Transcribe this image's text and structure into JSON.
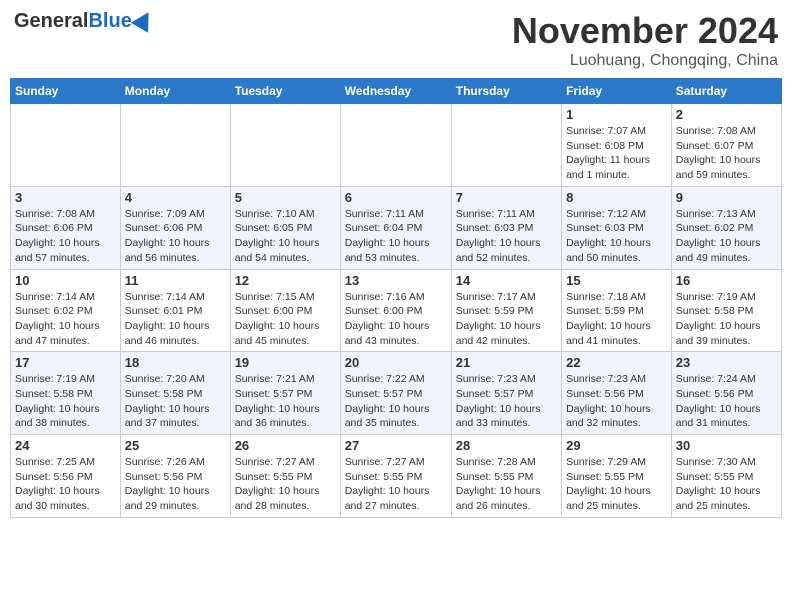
{
  "header": {
    "logo_general": "General",
    "logo_blue": "Blue",
    "month_title": "November 2024",
    "location": "Luohuang, Chongqing, China"
  },
  "weekdays": [
    "Sunday",
    "Monday",
    "Tuesday",
    "Wednesday",
    "Thursday",
    "Friday",
    "Saturday"
  ],
  "weeks": [
    [
      {
        "day": "",
        "info": ""
      },
      {
        "day": "",
        "info": ""
      },
      {
        "day": "",
        "info": ""
      },
      {
        "day": "",
        "info": ""
      },
      {
        "day": "",
        "info": ""
      },
      {
        "day": "1",
        "info": "Sunrise: 7:07 AM\nSunset: 6:08 PM\nDaylight: 11 hours and 1 minute."
      },
      {
        "day": "2",
        "info": "Sunrise: 7:08 AM\nSunset: 6:07 PM\nDaylight: 10 hours and 59 minutes."
      }
    ],
    [
      {
        "day": "3",
        "info": "Sunrise: 7:08 AM\nSunset: 6:06 PM\nDaylight: 10 hours and 57 minutes."
      },
      {
        "day": "4",
        "info": "Sunrise: 7:09 AM\nSunset: 6:06 PM\nDaylight: 10 hours and 56 minutes."
      },
      {
        "day": "5",
        "info": "Sunrise: 7:10 AM\nSunset: 6:05 PM\nDaylight: 10 hours and 54 minutes."
      },
      {
        "day": "6",
        "info": "Sunrise: 7:11 AM\nSunset: 6:04 PM\nDaylight: 10 hours and 53 minutes."
      },
      {
        "day": "7",
        "info": "Sunrise: 7:11 AM\nSunset: 6:03 PM\nDaylight: 10 hours and 52 minutes."
      },
      {
        "day": "8",
        "info": "Sunrise: 7:12 AM\nSunset: 6:03 PM\nDaylight: 10 hours and 50 minutes."
      },
      {
        "day": "9",
        "info": "Sunrise: 7:13 AM\nSunset: 6:02 PM\nDaylight: 10 hours and 49 minutes."
      }
    ],
    [
      {
        "day": "10",
        "info": "Sunrise: 7:14 AM\nSunset: 6:02 PM\nDaylight: 10 hours and 47 minutes."
      },
      {
        "day": "11",
        "info": "Sunrise: 7:14 AM\nSunset: 6:01 PM\nDaylight: 10 hours and 46 minutes."
      },
      {
        "day": "12",
        "info": "Sunrise: 7:15 AM\nSunset: 6:00 PM\nDaylight: 10 hours and 45 minutes."
      },
      {
        "day": "13",
        "info": "Sunrise: 7:16 AM\nSunset: 6:00 PM\nDaylight: 10 hours and 43 minutes."
      },
      {
        "day": "14",
        "info": "Sunrise: 7:17 AM\nSunset: 5:59 PM\nDaylight: 10 hours and 42 minutes."
      },
      {
        "day": "15",
        "info": "Sunrise: 7:18 AM\nSunset: 5:59 PM\nDaylight: 10 hours and 41 minutes."
      },
      {
        "day": "16",
        "info": "Sunrise: 7:19 AM\nSunset: 5:58 PM\nDaylight: 10 hours and 39 minutes."
      }
    ],
    [
      {
        "day": "17",
        "info": "Sunrise: 7:19 AM\nSunset: 5:58 PM\nDaylight: 10 hours and 38 minutes."
      },
      {
        "day": "18",
        "info": "Sunrise: 7:20 AM\nSunset: 5:58 PM\nDaylight: 10 hours and 37 minutes."
      },
      {
        "day": "19",
        "info": "Sunrise: 7:21 AM\nSunset: 5:57 PM\nDaylight: 10 hours and 36 minutes."
      },
      {
        "day": "20",
        "info": "Sunrise: 7:22 AM\nSunset: 5:57 PM\nDaylight: 10 hours and 35 minutes."
      },
      {
        "day": "21",
        "info": "Sunrise: 7:23 AM\nSunset: 5:57 PM\nDaylight: 10 hours and 33 minutes."
      },
      {
        "day": "22",
        "info": "Sunrise: 7:23 AM\nSunset: 5:56 PM\nDaylight: 10 hours and 32 minutes."
      },
      {
        "day": "23",
        "info": "Sunrise: 7:24 AM\nSunset: 5:56 PM\nDaylight: 10 hours and 31 minutes."
      }
    ],
    [
      {
        "day": "24",
        "info": "Sunrise: 7:25 AM\nSunset: 5:56 PM\nDaylight: 10 hours and 30 minutes."
      },
      {
        "day": "25",
        "info": "Sunrise: 7:26 AM\nSunset: 5:56 PM\nDaylight: 10 hours and 29 minutes."
      },
      {
        "day": "26",
        "info": "Sunrise: 7:27 AM\nSunset: 5:55 PM\nDaylight: 10 hours and 28 minutes."
      },
      {
        "day": "27",
        "info": "Sunrise: 7:27 AM\nSunset: 5:55 PM\nDaylight: 10 hours and 27 minutes."
      },
      {
        "day": "28",
        "info": "Sunrise: 7:28 AM\nSunset: 5:55 PM\nDaylight: 10 hours and 26 minutes."
      },
      {
        "day": "29",
        "info": "Sunrise: 7:29 AM\nSunset: 5:55 PM\nDaylight: 10 hours and 25 minutes."
      },
      {
        "day": "30",
        "info": "Sunrise: 7:30 AM\nSunset: 5:55 PM\nDaylight: 10 hours and 25 minutes."
      }
    ]
  ]
}
